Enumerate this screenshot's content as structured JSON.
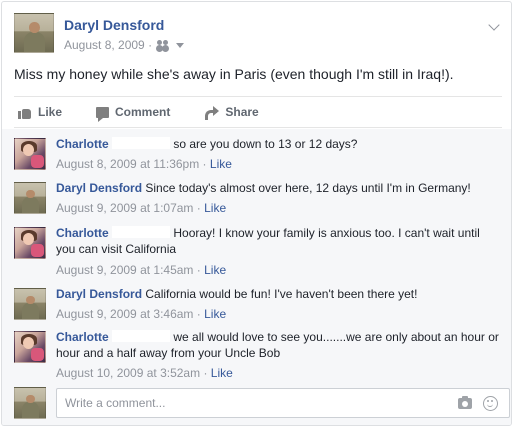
{
  "post": {
    "author": "Daryl Densford",
    "date": "August 8, 2009 ·",
    "text": "Miss my honey while she's away in Paris (even though I'm still in Iraq!)."
  },
  "actions": {
    "like": "Like",
    "comment": "Comment",
    "share": "Share"
  },
  "comments": [
    {
      "author": "Charlotte",
      "text": "so are you down to 13 or 12 days?",
      "timestamp": "August 8, 2009 at 11:36pm",
      "like": "Like"
    },
    {
      "author": "Daryl Densford",
      "text": "Since today's almost over here, 12 days until I'm in Germany!",
      "timestamp": "August 9, 2009 at 1:07am",
      "like": "Like"
    },
    {
      "author": "Charlotte",
      "text": "Hooray! I know your family is anxious too. I can't wait until you can visit California",
      "timestamp": "August 9, 2009 at 1:45am",
      "like": "Like"
    },
    {
      "author": "Daryl Densford",
      "text": "California would be fun! I've haven't been there yet!",
      "timestamp": "August 9, 2009 at 3:46am",
      "like": "Like"
    },
    {
      "author": "Charlotte",
      "text": "we all would love to see you.......we are only about an hour or hour and a half away from your Uncle Bob",
      "timestamp": "August 10, 2009 at 3:52am",
      "like": "Like"
    }
  ],
  "composer": {
    "placeholder": "Write a comment..."
  },
  "icons": {
    "audience": "friends-icon",
    "menu": "chevron-down-icon",
    "like": "thumbs-up-icon",
    "comment": "speech-bubble-icon",
    "share": "share-arrow-icon",
    "camera": "camera-icon",
    "emoji": "smiley-icon"
  },
  "colors": {
    "link": "#365899",
    "meta": "#90949c",
    "comments_bg": "#f6f7f9"
  }
}
